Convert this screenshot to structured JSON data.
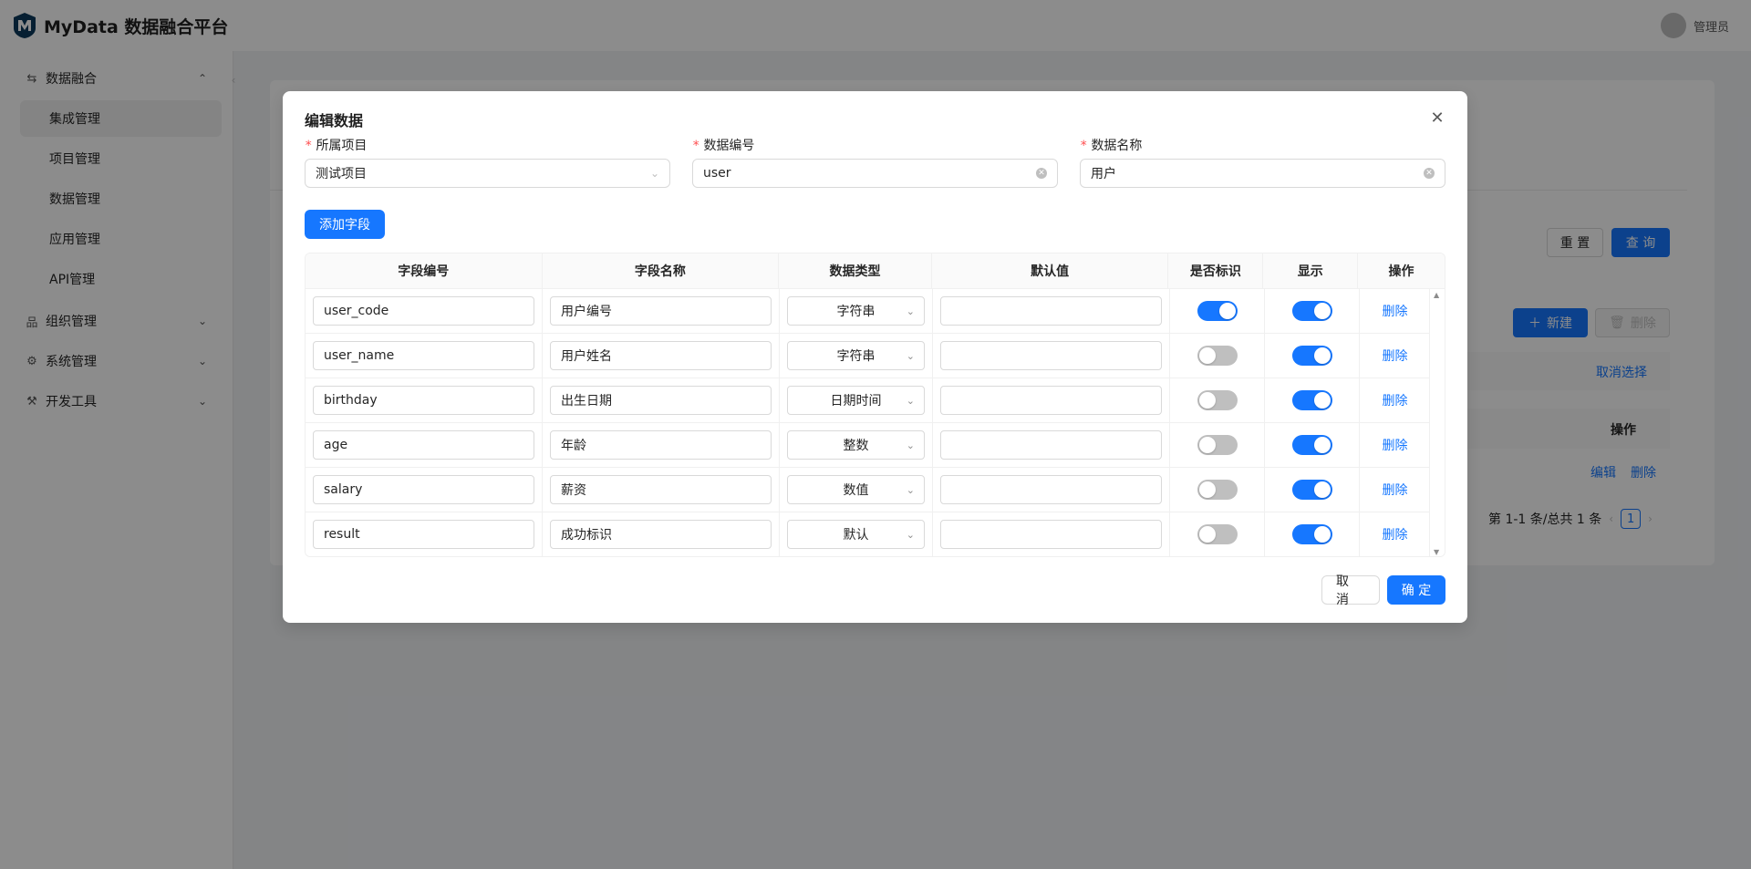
{
  "app": {
    "title": "MyData 数据融合平台",
    "user_name": "管理员",
    "accent_color": "#1677ff"
  },
  "sidebar": {
    "groups": [
      {
        "icon": "swap-icon",
        "label": "数据融合",
        "expanded": true,
        "items": [
          "集成管理",
          "项目管理",
          "数据管理",
          "应用管理",
          "API管理"
        ],
        "active": "集成管理"
      },
      {
        "icon": "org-icon",
        "label": "组织管理",
        "expanded": false
      },
      {
        "icon": "gear-icon",
        "label": "系统管理",
        "expanded": false
      },
      {
        "icon": "tool-icon",
        "label": "开发工具",
        "expanded": false
      }
    ]
  },
  "background": {
    "reset_label": "重 置",
    "query_label": "查 询",
    "new_label": "新建",
    "delete_label": "删除",
    "cancel_select_label": "取消选择",
    "ops_header": "操作",
    "edit_link": "编辑",
    "delete_link": "删除",
    "pager_total": "第 1-1 条/总共 1 条",
    "pager_current": "1"
  },
  "modal": {
    "title": "编辑数据",
    "fields": {
      "project": {
        "label": "所属项目",
        "value": "测试项目"
      },
      "code": {
        "label": "数据编号",
        "value": "user"
      },
      "name": {
        "label": "数据名称",
        "value": "用户"
      }
    },
    "add_field_label": "添加字段",
    "columns": [
      "字段编号",
      "字段名称",
      "数据类型",
      "默认值",
      "是否标识",
      "显示",
      "操作"
    ],
    "rows": [
      {
        "code": "user_code",
        "name": "用户编号",
        "type": "字符串",
        "default": "",
        "identity": true,
        "display": true,
        "action": "删除"
      },
      {
        "code": "user_name",
        "name": "用户姓名",
        "type": "字符串",
        "default": "",
        "identity": false,
        "display": true,
        "action": "删除"
      },
      {
        "code": "birthday",
        "name": "出生日期",
        "type": "日期时间",
        "default": "",
        "identity": false,
        "display": true,
        "action": "删除"
      },
      {
        "code": "age",
        "name": "年龄",
        "type": "整数",
        "default": "",
        "identity": false,
        "display": true,
        "action": "删除"
      },
      {
        "code": "salary",
        "name": "薪资",
        "type": "数值",
        "default": "",
        "identity": false,
        "display": true,
        "action": "删除"
      },
      {
        "code": "result",
        "name": "成功标识",
        "type": "默认",
        "default": "",
        "identity": false,
        "display": true,
        "action": "删除"
      }
    ],
    "cancel_label": "取 消",
    "ok_label": "确 定"
  }
}
